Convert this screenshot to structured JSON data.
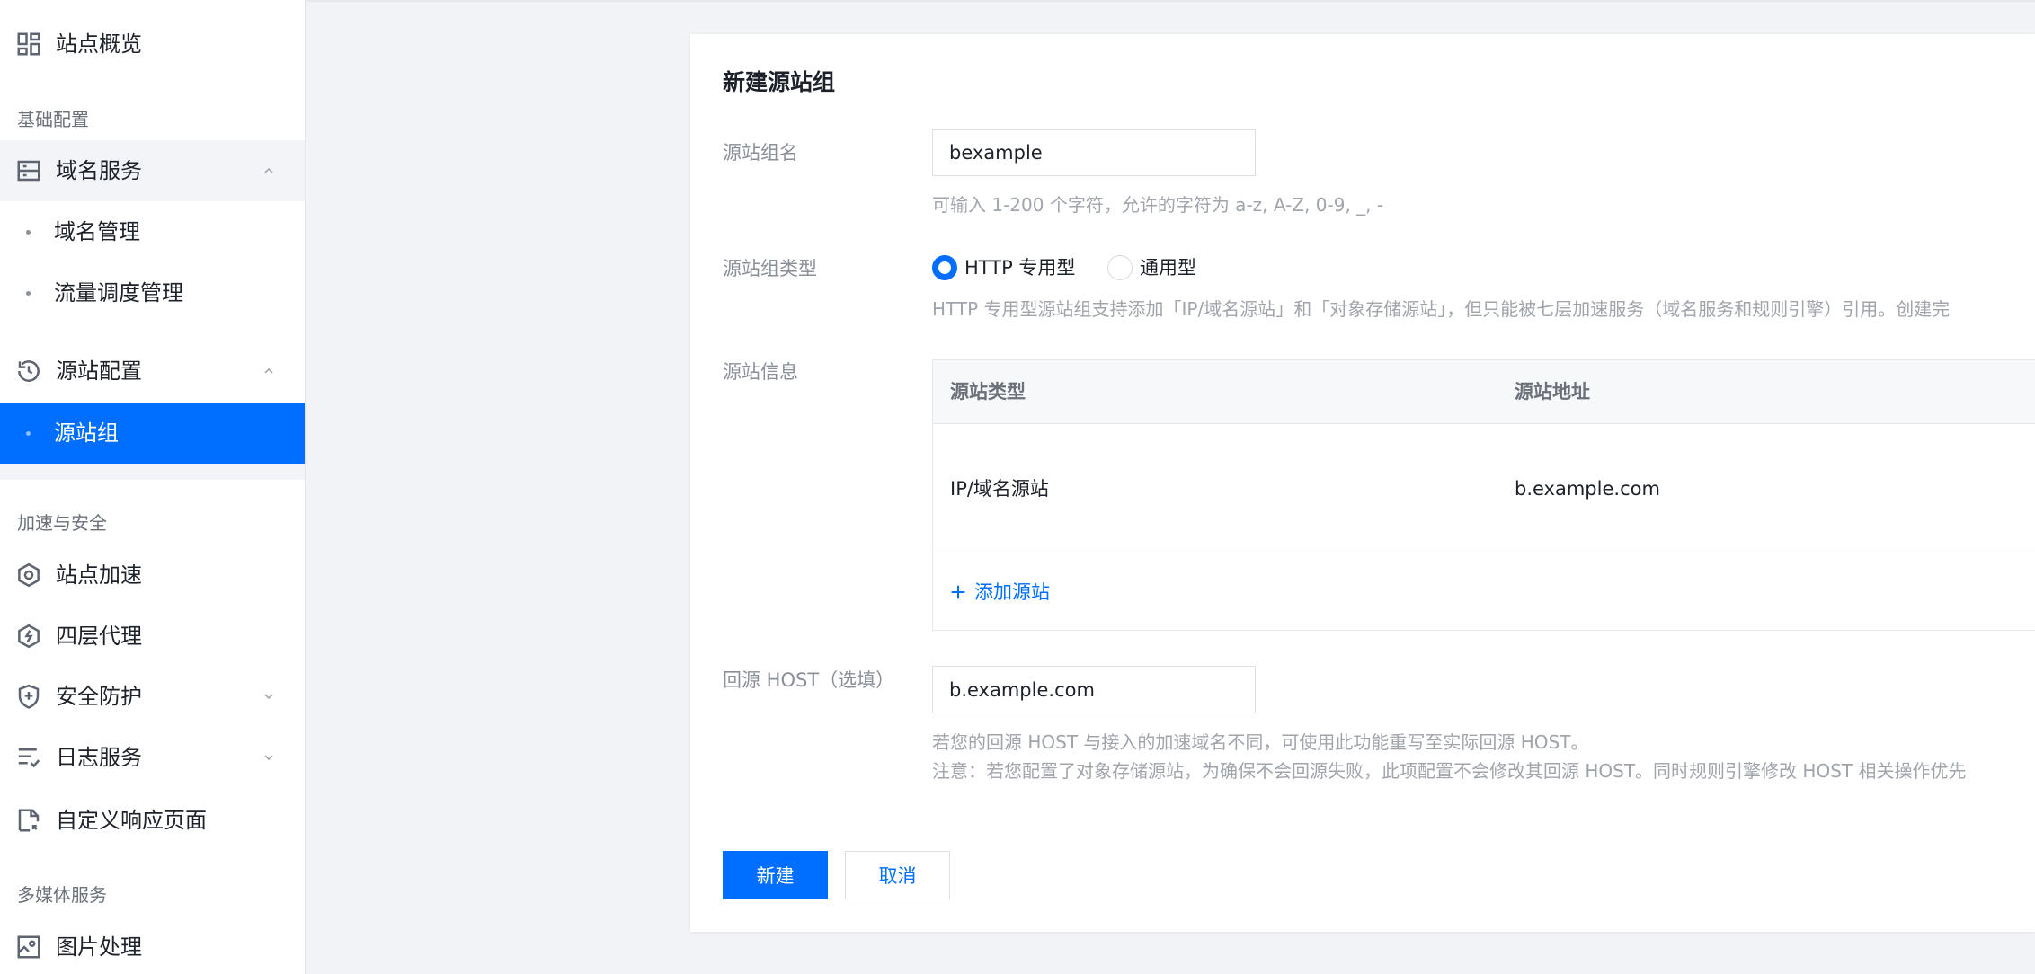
{
  "sidebar": {
    "overview": {
      "label": "站点概览",
      "icon": "dashboard-icon"
    },
    "section_basic": "基础配置",
    "domain_service": {
      "label": "域名服务",
      "icon": "server-icon",
      "expanded": true,
      "children": [
        {
          "label": "域名管理"
        },
        {
          "label": "流量调度管理"
        }
      ]
    },
    "origin_config": {
      "label": "源站配置",
      "icon": "history-icon",
      "expanded": true,
      "children": [
        {
          "label": "源站组",
          "active": true
        }
      ]
    },
    "section_accel": "加速与安全",
    "site_accel": {
      "label": "站点加速",
      "icon": "accelerate-icon"
    },
    "l4_proxy": {
      "label": "四层代理",
      "icon": "l4-proxy-icon"
    },
    "security": {
      "label": "安全防护",
      "icon": "shield-icon",
      "expanded": false
    },
    "logs": {
      "label": "日志服务",
      "icon": "log-list-icon",
      "expanded": false
    },
    "custom_page": {
      "label": "自定义响应页面",
      "icon": "custom-page-icon"
    },
    "section_media": "多媒体服务",
    "image_processing": {
      "label": "图片处理",
      "icon": "image-icon"
    }
  },
  "form": {
    "title": "新建源站组",
    "name": {
      "label": "源站组名",
      "value": "bexample",
      "help": "可输入 1-200 个字符，允许的字符为 a-z, A-Z, 0-9, _, -"
    },
    "type": {
      "label": "源站组类型",
      "options": [
        "HTTP 专用型",
        "通用型"
      ],
      "selected": "HTTP 专用型",
      "help": "HTTP 专用型源站组支持添加「IP/域名源站」和「对象存储源站」，但只能被七层加速服务（域名服务和规则引擎）引用。创建完"
    },
    "origins": {
      "label": "源站信息",
      "columns": [
        "源站类型",
        "源站地址"
      ],
      "rows": [
        {
          "type": "IP/域名源站",
          "address": "b.example.com"
        }
      ],
      "add_label": "添加源站"
    },
    "host": {
      "label": "回源 HOST（选填）",
      "value": "b.example.com",
      "help": [
        "若您的回源 HOST 与接入的加速域名不同，可使用此功能重写至实际回源 HOST。",
        "注意：若您配置了对象存储源站，为确保不会回源失败，此项配置不会修改其回源 HOST。同时规则引擎修改 HOST 相关操作优先"
      ]
    },
    "submit_label": "新建",
    "cancel_label": "取消"
  },
  "colors": {
    "accent": "#006eff",
    "page_bg": "#f2f3f6",
    "icon": "#5e6470"
  }
}
